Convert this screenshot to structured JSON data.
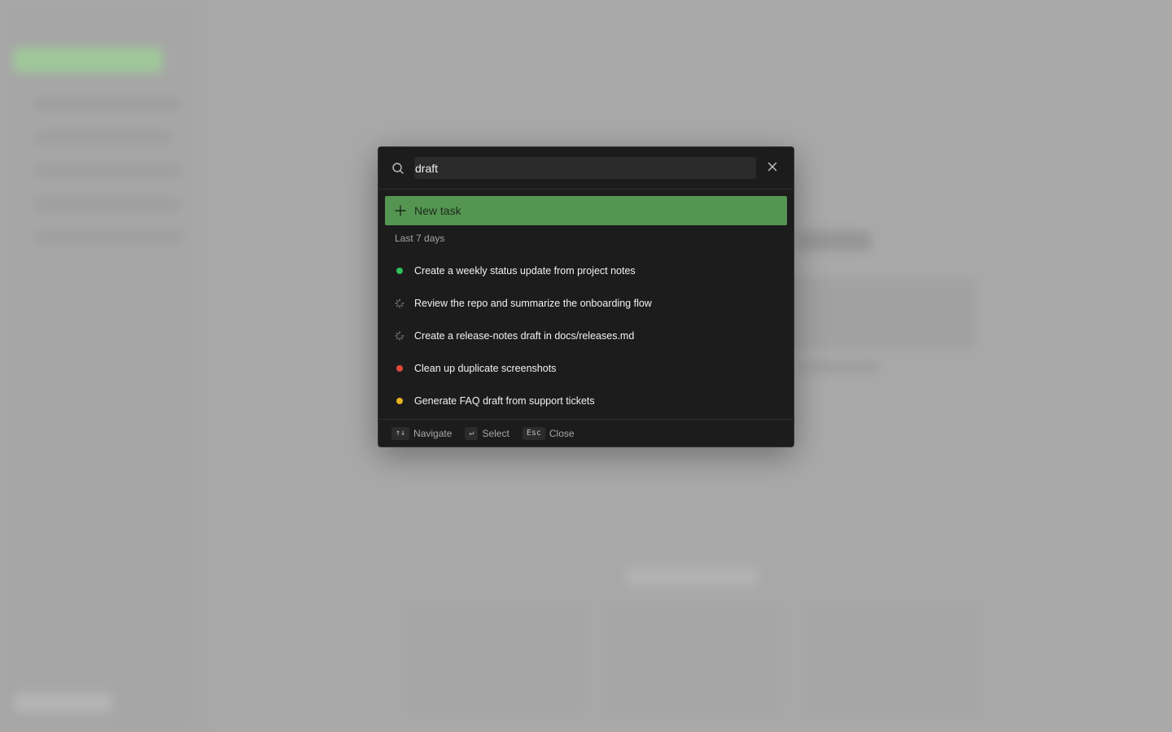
{
  "search": {
    "value": "draft",
    "icon": "search-icon"
  },
  "new_task": {
    "label": "New task"
  },
  "section": {
    "label": "Last 7 days"
  },
  "tasks": [
    {
      "title": "Create a weekly status update from project notes",
      "status": "done",
      "color": "#2fbf5b"
    },
    {
      "title": "Review the repo and summarize the onboarding flow",
      "status": "running",
      "color": "#8a8a8a"
    },
    {
      "title": "Create a release-notes draft in docs/releases.md",
      "status": "running",
      "color": "#8a8a8a"
    },
    {
      "title": "Clean up duplicate screenshots",
      "status": "failed",
      "color": "#e0483a"
    },
    {
      "title": "Generate FAQ draft from support tickets",
      "status": "pending",
      "color": "#e6b320"
    }
  ],
  "footer": {
    "navigate": {
      "key": "↑↓",
      "label": "Navigate"
    },
    "select": {
      "key": "↵",
      "label": "Select"
    },
    "close": {
      "key": "Esc",
      "label": "Close"
    }
  },
  "colors": {
    "accent": "#559552",
    "panel": "#1c1c1c"
  }
}
